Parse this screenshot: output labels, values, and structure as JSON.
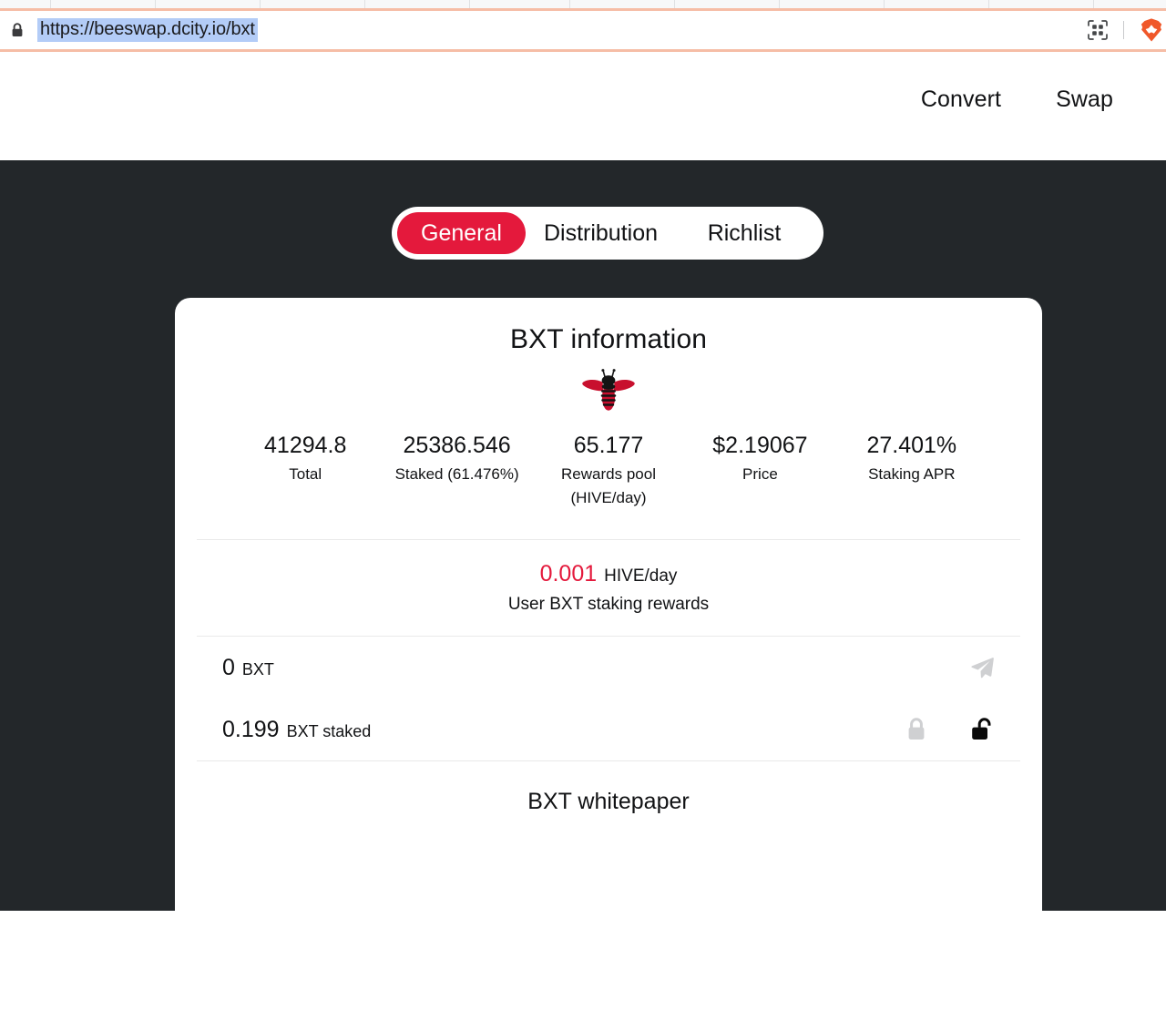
{
  "browser": {
    "url": "https://beeswap.dcity.io/bxt",
    "lock_icon": "lock-icon",
    "qr_icon": "qr-code-icon",
    "brave_icon": "brave-lion-icon"
  },
  "header": {
    "nav": [
      {
        "label": "Convert",
        "name": "nav-convert"
      },
      {
        "label": "Swap",
        "name": "nav-swap"
      }
    ]
  },
  "tabs": {
    "items": [
      {
        "label": "General",
        "active": true
      },
      {
        "label": "Distribution",
        "active": false
      },
      {
        "label": "Richlist",
        "active": false
      }
    ],
    "active_color": "#e4193c"
  },
  "card": {
    "title": "BXT information",
    "logo_icon": "bee-logo-icon",
    "stats": [
      {
        "value": "41294.8",
        "label": "Total"
      },
      {
        "value": "25386.546",
        "label": "Staked (61.476%)"
      },
      {
        "value": "65.177",
        "label": "Rewards pool",
        "label2": "(HIVE/day)"
      },
      {
        "value": "$2.19067",
        "label": "Price"
      },
      {
        "value": "27.401%",
        "label": "Staking APR"
      }
    ],
    "user_rewards": {
      "value": "0.001",
      "unit": "HIVE/day",
      "caption": "User BXT staking rewards",
      "value_color": "#e4193c"
    },
    "balances": [
      {
        "amount": "0",
        "unit": "BXT",
        "actions": [
          {
            "icon": "send-icon",
            "state": "disabled"
          }
        ]
      },
      {
        "amount": "0.199",
        "unit": "BXT staked",
        "actions": [
          {
            "icon": "lock-closed-icon",
            "state": "disabled"
          },
          {
            "icon": "lock-open-icon",
            "state": "enabled"
          }
        ]
      }
    ],
    "whitepaper_label": "BXT whitepaper"
  },
  "colors": {
    "page_background": "#23272a",
    "card_background": "#ffffff",
    "accent": "#e4193c",
    "text": "#111214",
    "divider": "#e9e9e9"
  }
}
